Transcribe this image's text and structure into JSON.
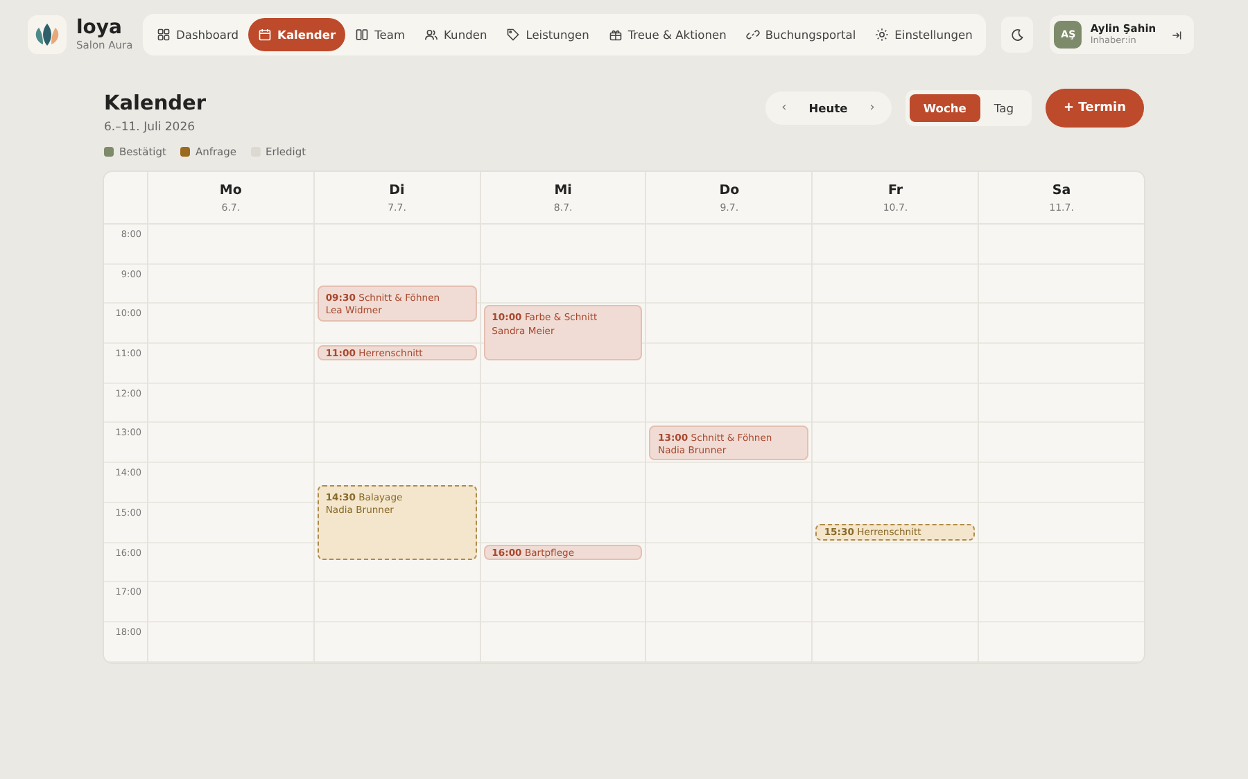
{
  "brand": {
    "name": "loya",
    "subtitle": "Salon Aura"
  },
  "nav": [
    {
      "label": "Dashboard",
      "selected": false
    },
    {
      "label": "Kalender",
      "selected": true
    },
    {
      "label": "Team",
      "selected": false
    },
    {
      "label": "Kunden",
      "selected": false
    },
    {
      "label": "Leistungen",
      "selected": false
    },
    {
      "label": "Treue & Aktionen",
      "selected": false
    },
    {
      "label": "Buchungsportal",
      "selected": false
    },
    {
      "label": "Einstellungen",
      "selected": false
    }
  ],
  "user": {
    "initials": "AŞ",
    "name": "Aylin Şahin",
    "role": "Inhaber:in"
  },
  "page": {
    "title": "Kalender",
    "range": "6.–11. Juli 2026"
  },
  "legend": [
    {
      "label": "Bestätigt",
      "color": "#7d8b6a"
    },
    {
      "label": "Anfrage",
      "color": "#9a6a1f"
    },
    {
      "label": "Erledigt",
      "color": "#dcd9d2"
    }
  ],
  "toolbar": {
    "prev": "‹",
    "today": "Heute",
    "next": "›",
    "views": [
      {
        "label": "Woche",
        "selected": true
      },
      {
        "label": "Tag",
        "selected": false
      }
    ],
    "add": "+ Termin"
  },
  "hours": [
    "8:00",
    "9:00",
    "10:00",
    "11:00",
    "12:00",
    "13:00",
    "14:00",
    "15:00",
    "16:00",
    "17:00",
    "18:00"
  ],
  "days": [
    {
      "name": "Mo",
      "date": "6.7."
    },
    {
      "name": "Di",
      "date": "7.7.",
      "events": [
        {
          "time": "09:30",
          "title": "Schnitt & Föhnen",
          "client": "Lea Widmer",
          "kind": "confirmed"
        },
        {
          "time": "11:00",
          "title": "Herrenschnitt",
          "kind": "confirmed"
        },
        {
          "time": "14:30",
          "title": "Balayage",
          "client": "Nadia Brunner",
          "kind": "request"
        }
      ]
    },
    {
      "name": "Mi",
      "date": "8.7.",
      "events": [
        {
          "time": "10:00",
          "title": "Farbe & Schnitt",
          "client": "Sandra Meier",
          "kind": "confirmed"
        },
        {
          "time": "16:00",
          "title": "Bartpflege",
          "kind": "confirmed"
        }
      ]
    },
    {
      "name": "Do",
      "date": "9.7.",
      "events": [
        {
          "time": "13:00",
          "title": "Schnitt & Föhnen",
          "client": "Nadia Brunner",
          "kind": "confirmed"
        }
      ]
    },
    {
      "name": "Fr",
      "date": "10.7.",
      "events": [
        {
          "time": "15:30",
          "title": "Herrenschnitt",
          "kind": "request"
        }
      ]
    },
    {
      "name": "Sa",
      "date": "11.7."
    }
  ]
}
